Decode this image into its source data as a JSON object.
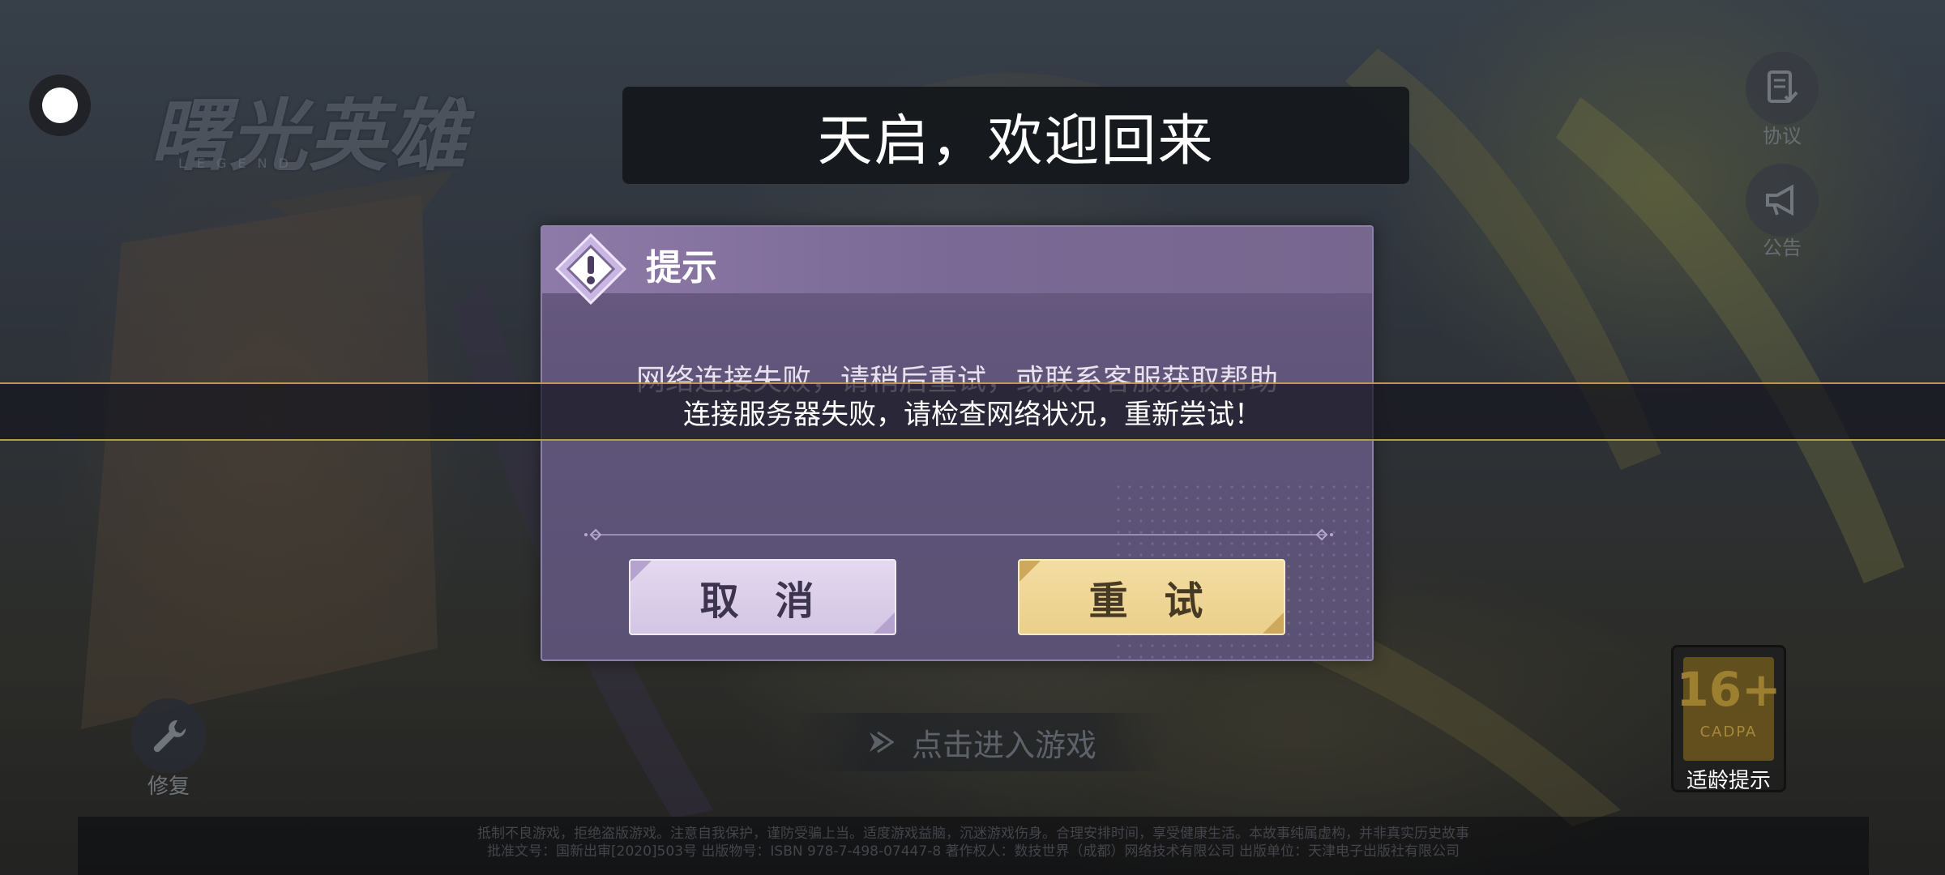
{
  "logo": {
    "title": "曙光英雄",
    "subtitle": "LEGEND"
  },
  "welcome_banner": "天启，欢迎回来",
  "side_buttons": {
    "agreement": "协议",
    "announcement": "公告"
  },
  "dialog": {
    "title": "提示",
    "message": "网络连接失败，请稍后重试，或联系客服获取帮助",
    "cancel_label": "取 消",
    "retry_label": "重 试"
  },
  "toast": "连接服务器失败，请检查网络状况，重新尝试！",
  "repair_label": "修复",
  "enter_game_label": "点击进入游戏",
  "age_rating": {
    "age": "16+",
    "org": "CADPA",
    "tip": "适龄提示"
  },
  "footer": {
    "line1": "抵制不良游戏，拒绝盗版游戏。注意自我保护，谨防受骗上当。适度游戏益脑，沉迷游戏伤身。合理安排时间，享受健康生活。本故事纯属虚构，并非真实历史故事",
    "line2": "批准文号：国新出审[2020]503号 出版物号：ISBN 978-7-498-07447-8 著作权人：数技世界（成都）网络技术有限公司 出版单位：天津电子出版社有限公司"
  },
  "colors": {
    "dialog_bg": "#5f5479",
    "dialog_header": "#8e7aa8",
    "cancel_button": "#d3c5e4",
    "retry_button": "#ebcf8b",
    "toast_border": "#b79a4e"
  }
}
